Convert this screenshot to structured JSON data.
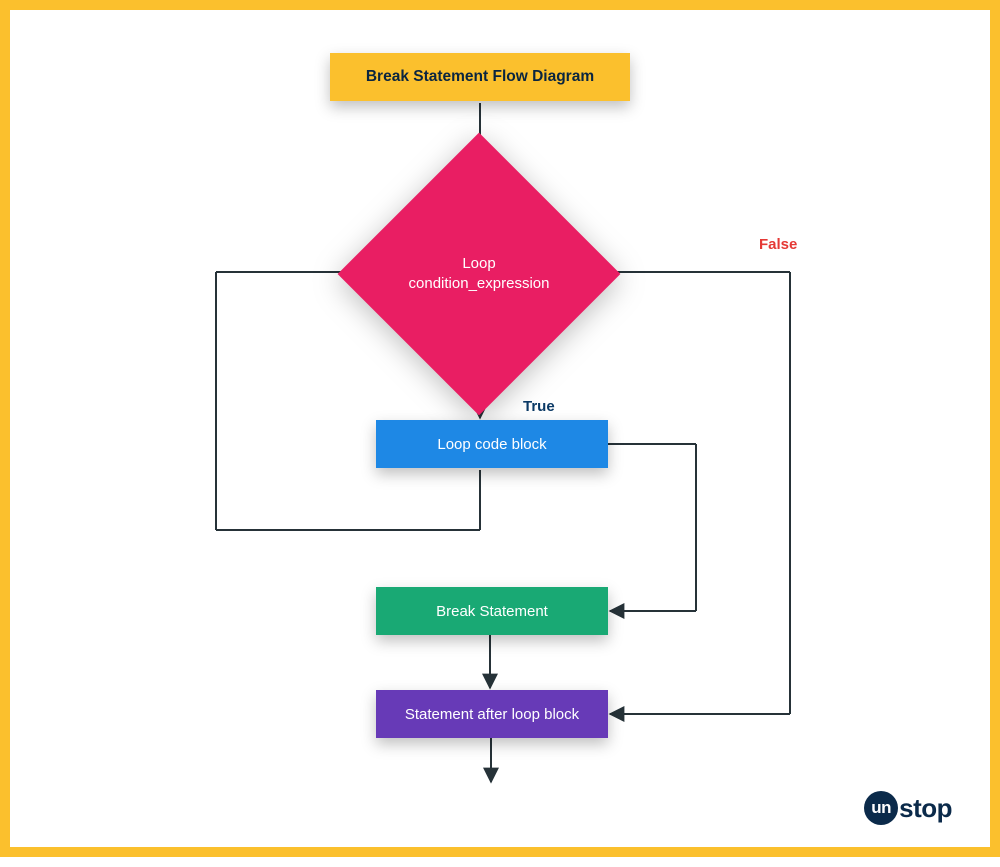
{
  "title": "Break Statement Flow Diagram",
  "nodes": {
    "condition": "Loop\ncondition_expression",
    "code_block": "Loop code block",
    "break_stmt": "Break Statement",
    "after_loop": "Statement after loop block"
  },
  "edge_labels": {
    "true": "True",
    "false": "False"
  },
  "brand": {
    "logo_badge": "un",
    "logo_text": "stop"
  },
  "colors": {
    "border": "#fbc02d",
    "title_bg": "#fbc02d",
    "condition": "#e91e63",
    "code_block": "#1e88e5",
    "break": "#19a974",
    "after": "#673ab7",
    "true_label": "#0b3a66",
    "false_label": "#e53935",
    "arrow": "#263238"
  }
}
